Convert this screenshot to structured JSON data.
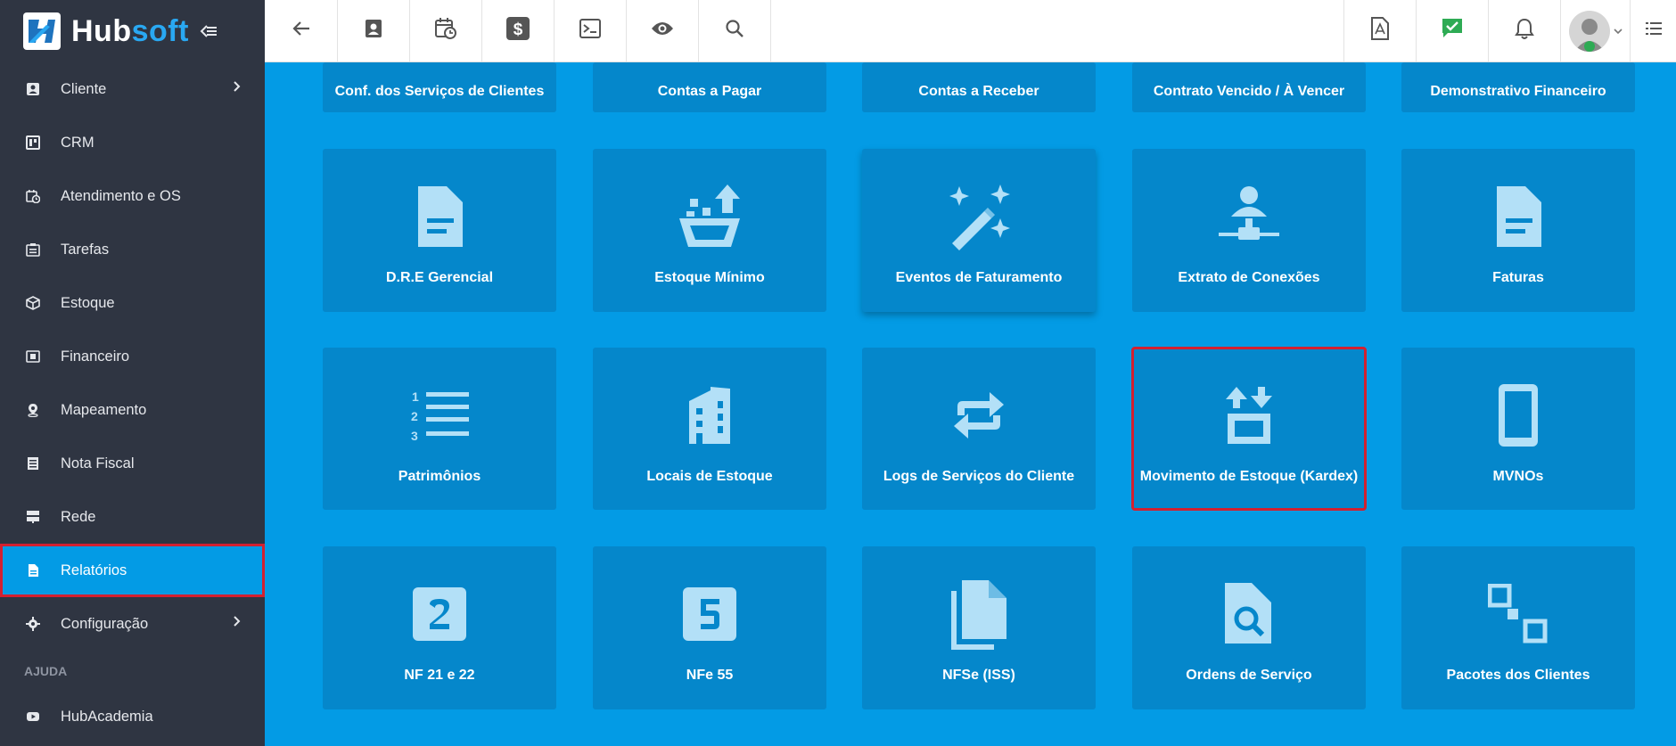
{
  "brand": {
    "name_part1": "Hub",
    "name_part2": "soft"
  },
  "sidebar": {
    "items": [
      {
        "label": "Cliente",
        "icon": "person-card-icon",
        "has_arrow": true
      },
      {
        "label": "CRM",
        "icon": "kanban-icon",
        "has_arrow": false
      },
      {
        "label": "Atendimento e OS",
        "icon": "calendar-clock-icon",
        "has_arrow": false
      },
      {
        "label": "Tarefas",
        "icon": "tasks-icon",
        "has_arrow": false
      },
      {
        "label": "Estoque",
        "icon": "box-icon",
        "has_arrow": false
      },
      {
        "label": "Financeiro",
        "icon": "money-icon",
        "has_arrow": false
      },
      {
        "label": "Mapeamento",
        "icon": "map-pin-icon",
        "has_arrow": false
      },
      {
        "label": "Nota Fiscal",
        "icon": "receipt-icon",
        "has_arrow": false
      },
      {
        "label": "Rede",
        "icon": "server-icon",
        "has_arrow": false
      },
      {
        "label": "Relatórios",
        "icon": "document-icon",
        "has_arrow": false,
        "active": true
      },
      {
        "label": "Configuração",
        "icon": "gear-icon",
        "has_arrow": true
      }
    ],
    "section_help": "AJUDA",
    "help_items": [
      {
        "label": "HubAcademia",
        "icon": "youtube-icon"
      }
    ]
  },
  "topbar": {
    "left_icons": [
      "back-arrow-icon",
      "contact-card-icon",
      "calendar-clock-icon",
      "dollar-icon",
      "terminal-icon",
      "eye-icon",
      "search-icon"
    ],
    "right_icons": [
      "pdf-icon",
      "chat-check-icon",
      "bell-icon"
    ]
  },
  "cards": {
    "row0": [
      {
        "label": "Conf. dos Serviços de Clientes"
      },
      {
        "label": "Contas a Pagar"
      },
      {
        "label": "Contas a Receber"
      },
      {
        "label": "Contrato Vencido / À Vencer"
      },
      {
        "label": "Demonstrativo Financeiro"
      }
    ],
    "row1": [
      {
        "label": "D.R.E Gerencial",
        "icon": "document-icon"
      },
      {
        "label": "Estoque Mínimo",
        "icon": "basket-upload-icon"
      },
      {
        "label": "Eventos de Faturamento",
        "icon": "magic-wand-icon"
      },
      {
        "label": "Extrato de Conexões",
        "icon": "person-network-icon"
      },
      {
        "label": "Faturas",
        "icon": "document-icon"
      }
    ],
    "row2": [
      {
        "label": "Patrimônios",
        "icon": "numbered-list-icon"
      },
      {
        "label": "Locais de Estoque",
        "icon": "building-icon"
      },
      {
        "label": "Logs de Serviços do Cliente",
        "icon": "repeat-icon"
      },
      {
        "label": "Movimento de Estoque (Kardex)",
        "icon": "transfer-box-icon"
      },
      {
        "label": "MVNOs",
        "icon": "phone-icon"
      }
    ],
    "row3": [
      {
        "label": "NF 21 e 22",
        "icon": "number-2-box-icon"
      },
      {
        "label": "NFe 55",
        "icon": "number-5-box-icon"
      },
      {
        "label": "NFSe (ISS)",
        "icon": "files-icon"
      },
      {
        "label": "Ordens de Serviço",
        "icon": "file-search-icon"
      },
      {
        "label": "Pacotes dos Clientes",
        "icon": "package-nodes-icon"
      }
    ]
  },
  "colors": {
    "sidebar_bg": "#2f3542",
    "accent_blue": "#039be5",
    "card_bg": "#0587cb",
    "icon_light": "#b3e0f7",
    "highlight_red": "#d32030"
  }
}
